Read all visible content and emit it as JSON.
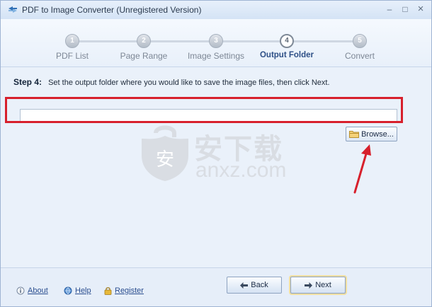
{
  "window": {
    "title": "PDF to Image Converter (Unregistered Version)",
    "minimize_glyph": "–",
    "maximize_glyph": "□",
    "close_glyph": "×"
  },
  "steps": [
    {
      "number": "1",
      "label": "PDF List"
    },
    {
      "number": "2",
      "label": "Page Range"
    },
    {
      "number": "3",
      "label": "Image Settings"
    },
    {
      "number": "4",
      "label": "Output Folder"
    },
    {
      "number": "5",
      "label": "Convert"
    }
  ],
  "active_step": 4,
  "main": {
    "step_no": "Step 4:",
    "instruction": "Set the output folder where you would like to save the image files, then click Next.",
    "folder_value": "",
    "browse_label": "Browse...",
    "browse_icon": "folder-icon"
  },
  "watermark": {
    "chinese_text": "安下载",
    "english_text": "anxz.com",
    "shield_text": "安"
  },
  "footer": {
    "about_label": "About",
    "about_icon": "info-icon",
    "help_label": "Help",
    "help_icon": "help-globe-icon",
    "register_label": "Register",
    "register_icon": "lock-icon",
    "back_label": "Back",
    "next_label": "Next"
  },
  "colors": {
    "highlight": "#d7202c",
    "accent": "#2d4f86",
    "window_bg": "#eaf1fa"
  }
}
